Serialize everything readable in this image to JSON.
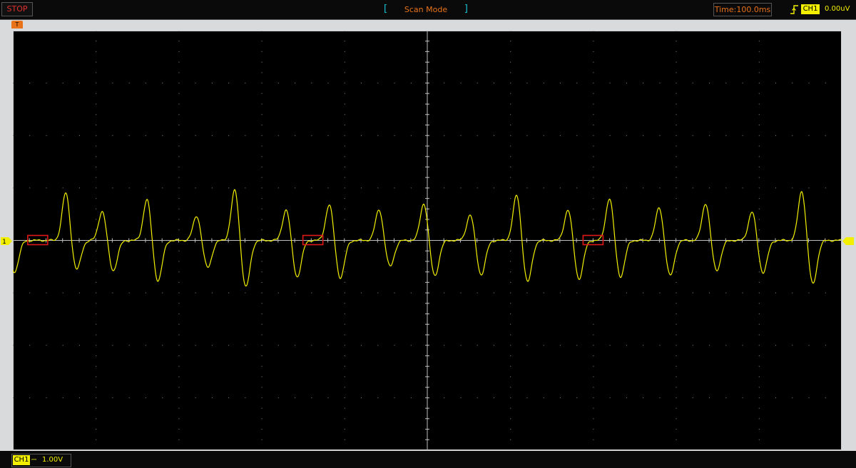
{
  "topbar": {
    "run_state": "STOP",
    "mode": "Scan Mode",
    "timebase": "Time:100.0ms",
    "trigger_channel": "CH1",
    "trigger_level": "0.00uV"
  },
  "trigger_position_marker": "T",
  "channel_marker": "1",
  "bottombar": {
    "channel": "CH1",
    "coupling": "⎓",
    "scale": "1.00V"
  },
  "colors": {
    "trace": "#f2f000",
    "grid": "#8a8a8a",
    "run_state": "#e33030",
    "status_text": "#e8731a",
    "highlight_box": "#e01818"
  },
  "icons": [
    "rising-edge-trigger-icon",
    "channel-reference-marker-icon"
  ],
  "chart_data": {
    "type": "line",
    "grid": true,
    "divisions": {
      "horizontal": 10,
      "vertical": 8
    },
    "x_range_ms": [
      -500,
      500
    ],
    "y_range_div": [
      -4,
      4
    ],
    "series": [
      {
        "name": "CH1",
        "beats": [
          {
            "t_div": -4.36,
            "pos": 0.92,
            "neg": -0.56,
            "order": "pos-first"
          },
          {
            "t_div": -3.92,
            "pos": 0.57,
            "neg": -0.58,
            "order": "pos-first"
          },
          {
            "t_div": -3.38,
            "pos": 0.8,
            "neg": -0.78,
            "order": "pos-first"
          },
          {
            "t_div": -2.78,
            "pos": 0.48,
            "neg": -0.52,
            "order": "pos-first"
          },
          {
            "t_div": -2.32,
            "pos": 0.98,
            "neg": -0.9,
            "order": "pos-first"
          },
          {
            "t_div": -1.7,
            "pos": 0.6,
            "neg": -0.7,
            "order": "pos-first"
          },
          {
            "t_div": -1.18,
            "pos": 0.7,
            "neg": -0.72,
            "order": "pos-first"
          },
          {
            "t_div": -0.58,
            "pos": 0.6,
            "neg": -0.5,
            "order": "pos-first"
          },
          {
            "t_div": -0.04,
            "pos": 0.72,
            "neg": -0.68,
            "order": "pos-first"
          },
          {
            "t_div": 0.52,
            "pos": 0.5,
            "neg": -0.66,
            "order": "pos-first"
          },
          {
            "t_div": 1.08,
            "pos": 0.88,
            "neg": -0.8,
            "order": "pos-first"
          },
          {
            "t_div": 1.7,
            "pos": 0.6,
            "neg": -0.74,
            "order": "pos-first"
          },
          {
            "t_div": 2.2,
            "pos": 0.82,
            "neg": -0.7,
            "order": "pos-first"
          },
          {
            "t_div": 2.8,
            "pos": 0.64,
            "neg": -0.68,
            "order": "pos-first"
          },
          {
            "t_div": 3.36,
            "pos": 0.72,
            "neg": -0.58,
            "order": "pos-first"
          },
          {
            "t_div": 3.92,
            "pos": 0.56,
            "neg": -0.62,
            "order": "pos-first"
          },
          {
            "t_div": 4.52,
            "pos": 0.96,
            "neg": -0.84,
            "order": "pos-first"
          },
          {
            "t_div": -4.98,
            "pos": 0.0,
            "neg": -0.6,
            "order": "neg-only"
          }
        ]
      }
    ],
    "highlight_boxes_t_div": [
      -4.7,
      -1.38,
      2.0
    ]
  }
}
